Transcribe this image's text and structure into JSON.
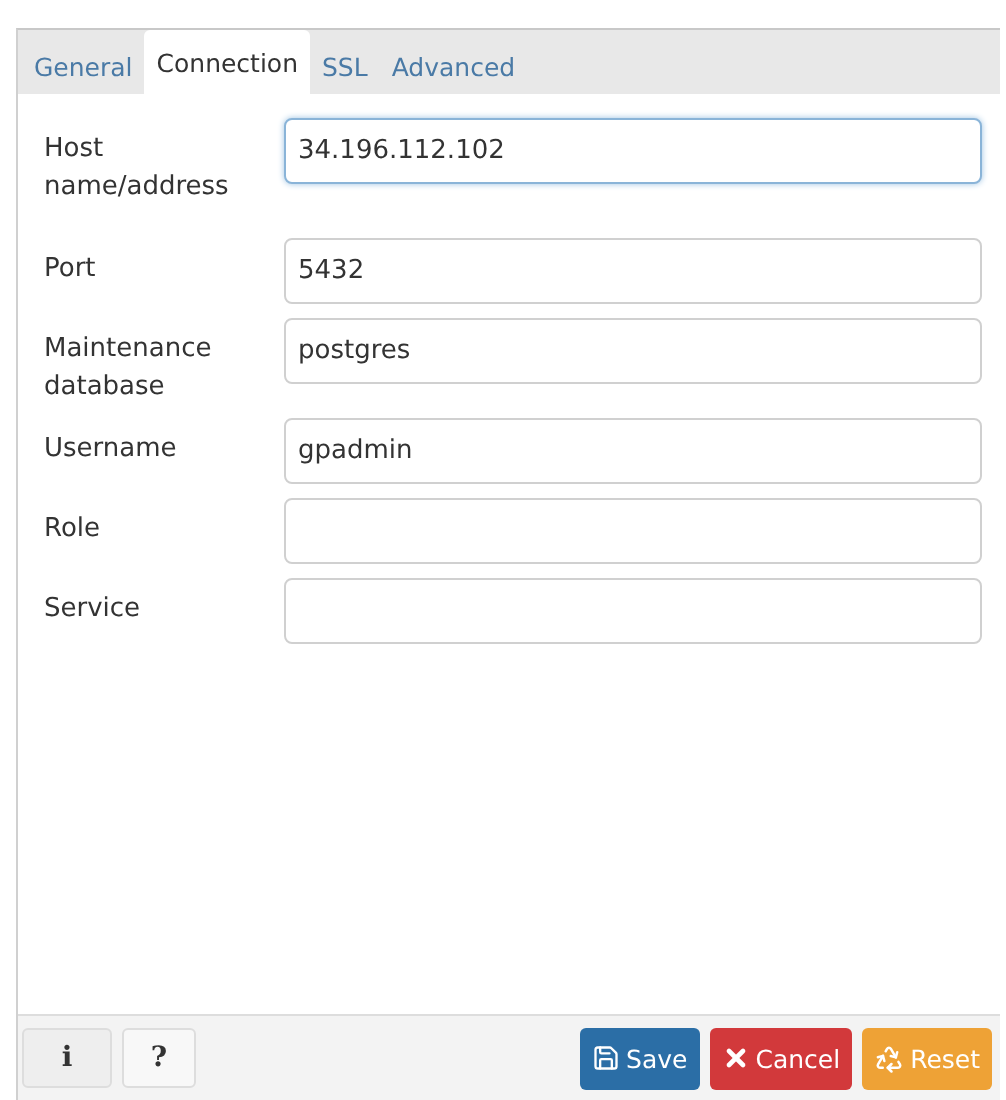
{
  "tabs": [
    {
      "label": "General",
      "selected": false
    },
    {
      "label": "Connection",
      "selected": true
    },
    {
      "label": "SSL",
      "selected": false
    },
    {
      "label": "Advanced",
      "selected": false
    }
  ],
  "fields": [
    {
      "label": "Host name/address",
      "value": "34.196.112.102",
      "focused": true
    },
    {
      "label": "Port",
      "value": "5432",
      "focused": false
    },
    {
      "label": "Maintenance database",
      "value": "postgres",
      "focused": false
    },
    {
      "label": "Username",
      "value": "gpadmin",
      "focused": false
    },
    {
      "label": "Role",
      "focused": false
    },
    {
      "label": "Service",
      "focused": false
    }
  ],
  "footer": {
    "left_buttons": [
      {
        "kind": "info",
        "label": "i"
      },
      {
        "kind": "help",
        "label": "?"
      }
    ],
    "right_buttons": [
      {
        "kind": "save",
        "label": "Save"
      },
      {
        "kind": "cancel",
        "label": "Cancel"
      },
      {
        "kind": "reset",
        "label": "Reset"
      }
    ]
  }
}
